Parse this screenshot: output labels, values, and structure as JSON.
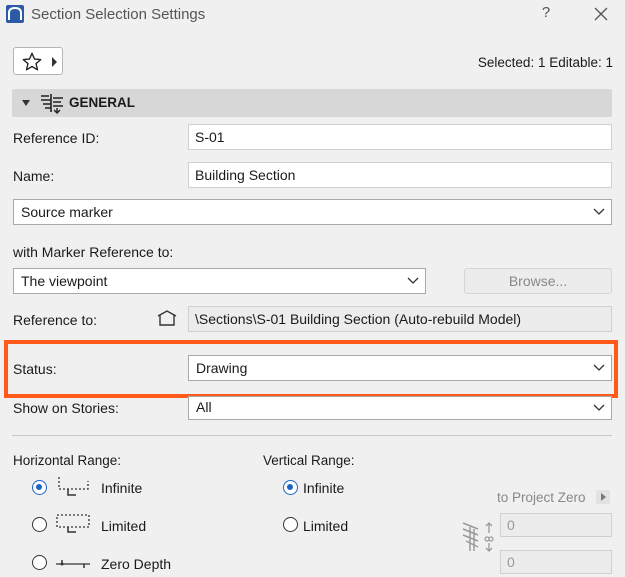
{
  "window": {
    "title": "Section Selection Settings",
    "help": "?"
  },
  "selection": {
    "info": "Selected: 1 Editable: 1"
  },
  "general": {
    "header": "GENERAL",
    "reference_id_label": "Reference ID:",
    "reference_id_value": "S-01",
    "name_label": "Name:",
    "name_value": "Building Section",
    "marker_type": "Source marker",
    "marker_reference_label": "with Marker Reference to:",
    "marker_reference_value": "The viewpoint",
    "browse_label": "Browse...",
    "reference_to_label": "Reference to:",
    "reference_to_value": "\\Sections\\S-01 Building Section (Auto-rebuild Model)",
    "status_label": "Status:",
    "status_value": "Drawing",
    "stories_label": "Show on Stories:",
    "stories_value": "All"
  },
  "horizontal_range": {
    "label": "Horizontal Range:",
    "options": [
      {
        "label": "Infinite",
        "selected": true
      },
      {
        "label": "Limited",
        "selected": false
      },
      {
        "label": "Zero Depth",
        "selected": false
      }
    ]
  },
  "vertical_range": {
    "label": "Vertical Range:",
    "options": [
      {
        "label": "Infinite",
        "selected": true
      },
      {
        "label": "Limited",
        "selected": false
      }
    ],
    "to_project_zero": "to Project Zero",
    "top_value": "0",
    "bottom_value": "0"
  },
  "colors": {
    "accent": "#1e64c8",
    "highlight": "#ff5a1a"
  }
}
